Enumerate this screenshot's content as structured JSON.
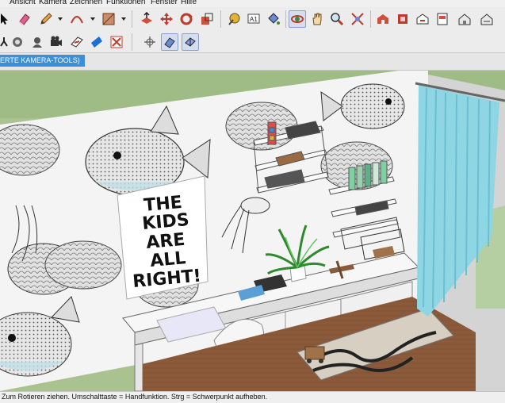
{
  "menu": {
    "items": [
      "Ansicht",
      "Kamera",
      "Zeichnen",
      "Funktionen",
      "Fenster",
      "Hilfe"
    ]
  },
  "scene": {
    "tab_label": "ERTE KAMERA-TOOLS)",
    "poster_lines": [
      "THE",
      "KIDS",
      "ARE",
      "ALL",
      "RIGHT!"
    ]
  },
  "status": {
    "text": "Zum Rotieren ziehen. Umschalttaste = Handfunktion. Strg = Schwerpunkt aufheben."
  },
  "icons": {
    "row1": [
      "select-arrow-icon",
      "eraser-icon",
      "pencil-icon",
      "arc-icon",
      "rectangle-icon",
      "push-pull-icon",
      "move-icon",
      "rotate-icon",
      "scale-icon",
      "tape-measure-icon",
      "text-icon",
      "paint-bucket-icon",
      "orbit-icon",
      "pan-icon",
      "zoom-icon",
      "zoom-extents-icon",
      "warehouse-icon",
      "extension-icon",
      "share-model-icon",
      "layout-icon",
      "components-icon",
      "styles-icon"
    ],
    "row2": [
      "walk-icon",
      "position-camera-icon",
      "look-around-icon",
      "film-camera-icon",
      "section-plane-icon",
      "section-display-icon",
      "section-cut-icon",
      "axes-icon",
      "xray-icon",
      "back-edges-icon"
    ]
  },
  "colors": {
    "accent": "#3b8fd9",
    "curtain": "#8ed6e4",
    "floor": "#8a5a3a",
    "active_tool": "#d4deef"
  }
}
